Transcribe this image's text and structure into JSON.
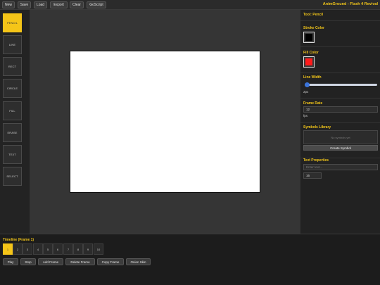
{
  "menubar": {
    "buttons": [
      "New",
      "Save",
      "Load",
      "Export",
      "Clear",
      "GoScript"
    ],
    "app_title": "AnimGround - Flash 4 Revival"
  },
  "tools": {
    "items": [
      "PENCIL",
      "LINE",
      "RECT",
      "CIRCLE",
      "FILL",
      "ERASE",
      "TEXT",
      "SELECT"
    ],
    "active": "PENCIL"
  },
  "panel": {
    "tool_label": "Tool: Pencil",
    "stroke": {
      "title": "Stroke Color",
      "color": "#000000"
    },
    "fill": {
      "title": "Fill Color",
      "color": "#ff1a1a"
    },
    "line_width": {
      "title": "Line Width",
      "value_label": "2px",
      "fraction": 0.02
    },
    "frame_rate": {
      "title": "Frame Rate",
      "value": "12",
      "unit": "fps"
    },
    "symbol_library": {
      "title": "Symbols Library",
      "empty_text": "No symbols yet",
      "create_label": "Create Symbol"
    },
    "text_properties": {
      "title": "Text Properties",
      "placeholder": "Enter text...",
      "size_value": "16"
    }
  },
  "timeline": {
    "title": "Timeline (Frame 1)",
    "frames": [
      "1",
      "2",
      "3",
      "4",
      "5",
      "6",
      "7",
      "8",
      "9",
      "10"
    ],
    "active_frame": "1",
    "buttons": [
      "Play",
      "Stop",
      "Add Frame",
      "Delete Frame",
      "Copy Frame",
      "Onion Skin"
    ]
  },
  "colors": {
    "accent": "#f5c518",
    "stage_bg": "#353535",
    "canvas_bg": "#ffffff"
  }
}
